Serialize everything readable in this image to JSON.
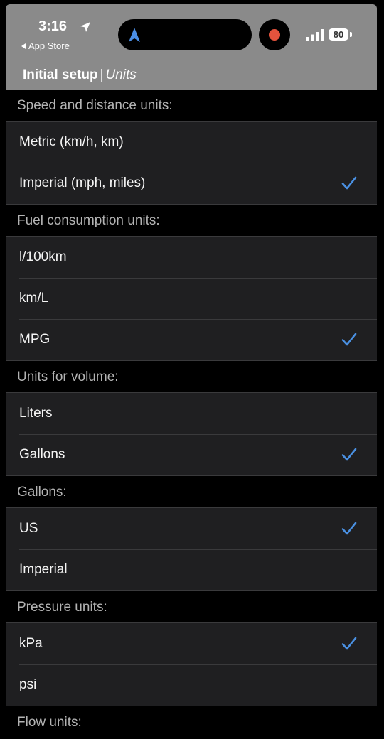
{
  "status_bar": {
    "time": "3:16",
    "back_app": "App Store",
    "battery": "80"
  },
  "nav": {
    "title": "Initial setup",
    "separator": "|",
    "subtitle": "Units"
  },
  "accent_color": "#4a90e2",
  "sections": [
    {
      "header": "Speed and distance units:",
      "options": [
        {
          "label": "Metric (km/h, km)",
          "selected": false
        },
        {
          "label": "Imperial (mph, miles)",
          "selected": true
        }
      ]
    },
    {
      "header": "Fuel consumption units:",
      "options": [
        {
          "label": "l/100km",
          "selected": false
        },
        {
          "label": "km/L",
          "selected": false
        },
        {
          "label": "MPG",
          "selected": true
        }
      ]
    },
    {
      "header": "Units for volume:",
      "options": [
        {
          "label": "Liters",
          "selected": false
        },
        {
          "label": "Gallons",
          "selected": true
        }
      ]
    },
    {
      "header": "Gallons:",
      "options": [
        {
          "label": "US",
          "selected": true
        },
        {
          "label": "Imperial",
          "selected": false
        }
      ]
    },
    {
      "header": "Pressure units:",
      "options": [
        {
          "label": "kPa",
          "selected": true
        },
        {
          "label": "psi",
          "selected": false
        }
      ]
    },
    {
      "header": "Flow units:",
      "options": []
    }
  ]
}
